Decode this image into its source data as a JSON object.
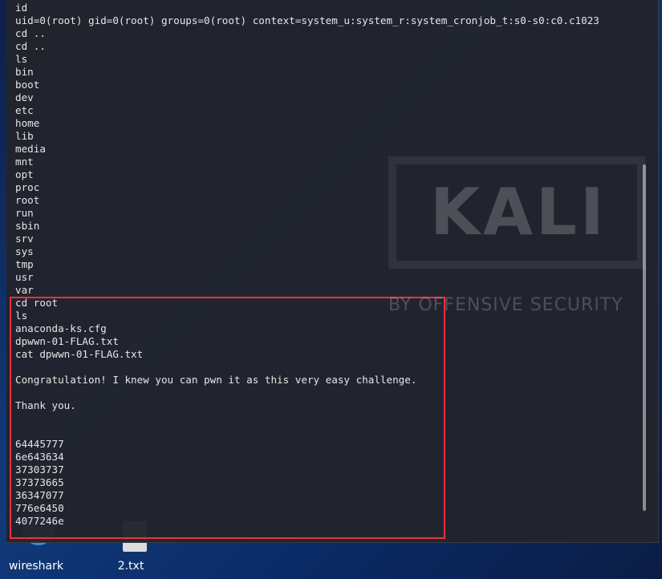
{
  "terminal": {
    "lines": [
      "id",
      "uid=0(root) gid=0(root) groups=0(root) context=system_u:system_r:system_cronjob_t:s0-s0:c0.c1023",
      "cd ..",
      "cd ..",
      "ls",
      "bin",
      "boot",
      "dev",
      "etc",
      "home",
      "lib",
      "media",
      "mnt",
      "opt",
      "proc",
      "root",
      "run",
      "sbin",
      "srv",
      "sys",
      "tmp",
      "usr",
      "var",
      "cd root",
      "ls",
      "anaconda-ks.cfg",
      "dpwwn-01-FLAG.txt",
      "cat dpwwn-01-FLAG.txt",
      "",
      "Congratulation! I knew you can pwn it as this very easy challenge.",
      "",
      "Thank you.",
      "",
      "",
      "64445777",
      "6e643634",
      "37303737",
      "37373665",
      "36347077",
      "776e6450",
      "4077246e"
    ]
  },
  "wallpaper": {
    "logo": "KALI",
    "tagline": "BY OFFENSIVE SECURITY"
  },
  "desktop": {
    "icons": [
      {
        "label": "wireshark",
        "icon": "wireshark-icon"
      },
      {
        "label": "2.txt",
        "icon": "text-file-icon"
      }
    ]
  },
  "colors": {
    "highlight": "#f0303a",
    "terminal_bg": "#22242c",
    "text": "#e6e6e6"
  }
}
